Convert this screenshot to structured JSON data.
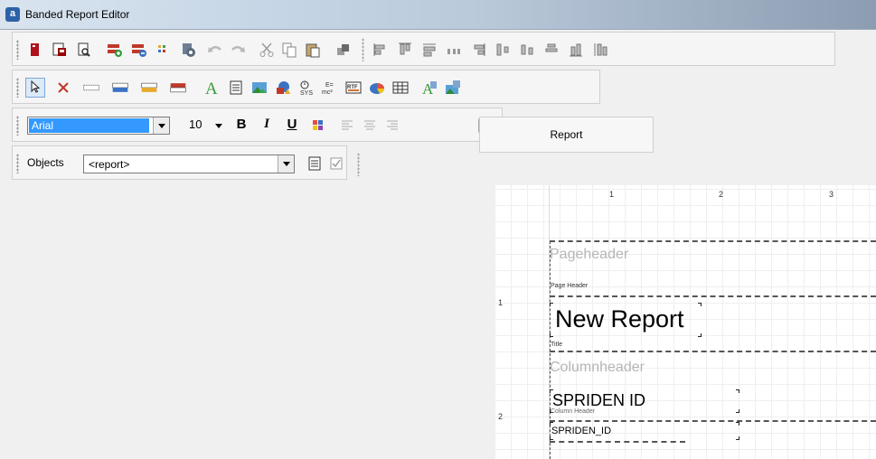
{
  "window": {
    "title": "Banded Report Editor",
    "app_icon": "a"
  },
  "toolbar_format": {
    "font_name": "Arial",
    "font_size": "10",
    "bold": "B",
    "italic": "I",
    "underline": "U"
  },
  "toolbar_objects": {
    "label": "Objects",
    "selected": "<report>"
  },
  "tab": {
    "label": "Report"
  },
  "ruler": {
    "top": [
      "1",
      "2",
      "3"
    ],
    "left": [
      "1",
      "2"
    ]
  },
  "design": {
    "pageheader_ghost": "Pageheader",
    "pageheader_label": "Page Header",
    "title_text": "New Report",
    "title_label": "Title",
    "columnheader_ghost": "Columnheader",
    "column_text": "SPRIDEN ID",
    "column_label": "Column Header",
    "detail_field": "SPRIDEN_ID"
  },
  "colors": {
    "selection": "#3399ff",
    "band_line": "#555555",
    "ghost_text": "#b5b5b5"
  }
}
